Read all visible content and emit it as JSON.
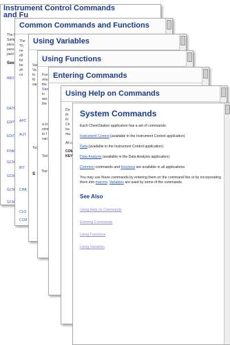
{
  "windows": [
    {
      "title": "Instrument Control Commands and Fu"
    },
    {
      "title": "Common Commands and Functions"
    },
    {
      "title": "Using Variables"
    },
    {
      "title": "Using Functions"
    },
    {
      "title": "Entering Commands"
    },
    {
      "title": "Using Help on Commands"
    }
  ],
  "front": {
    "title": "System Commands",
    "intro": "Each ChemStation application has a set of commands:",
    "items": [
      {
        "link": "Instrument Control",
        "text": " (available in the Instrument Control application)"
      },
      {
        "link": "Data",
        "text": " (available in the Instrument Control application)"
      },
      {
        "link": "Data Analysis",
        "text": " (available in the Data Analysis application)"
      }
    ],
    "common_link": "Common",
    "common_mid": " commands and ",
    "functions_link": "functions",
    "common_end": " are available in all applications.",
    "para_a": "You may use these commands by entering them on the command line or by incorporating them into ",
    "macros_link": "macros",
    "variables_link": "Variables",
    "para_b": " are used by some of the commands.",
    "see_also": "See Also",
    "see_also_links": [
      "Using Help on Commands",
      "Entering Commands",
      "Using Functions",
      "Using Variables"
    ]
  },
  "fragments": {
    "w1": [
      "The f",
      "Samp",
      "para",
      "para",
      "parti",
      "See"
    ],
    "w1_links": [
      "ABO",
      "DATP",
      "EDIT",
      "EDIT",
      "FINM",
      "GCM",
      "GCM",
      "GCM",
      "GCM",
      "GCM",
      "GCM",
      "GCM"
    ],
    "w2": [
      "The",
      "Th",
      "ne",
      "all",
      "fol",
      "bo",
      "sh",
      "co"
    ],
    "w2_links": [
      "APC",
      "AUT",
      "BIT",
      "CHA",
      "CLO",
      "CCM"
    ],
    "w3": [
      "Varia",
      "Va",
      "to",
      "th",
      "var",
      "Tod",
      "S"
    ],
    "w4": [
      "Fun",
      "retu",
      "the",
      "Nam",
      "in",
      "ass",
      "the",
      "a st",
      "strin",
      "to f",
      "vari",
      "Tod",
      "Nur"
    ],
    "w5": [
      "Do",
      "th",
      "Fr",
      "Ch",
      "tra",
      "ma",
      "All co",
      "COMI",
      "KEYV"
    ]
  }
}
